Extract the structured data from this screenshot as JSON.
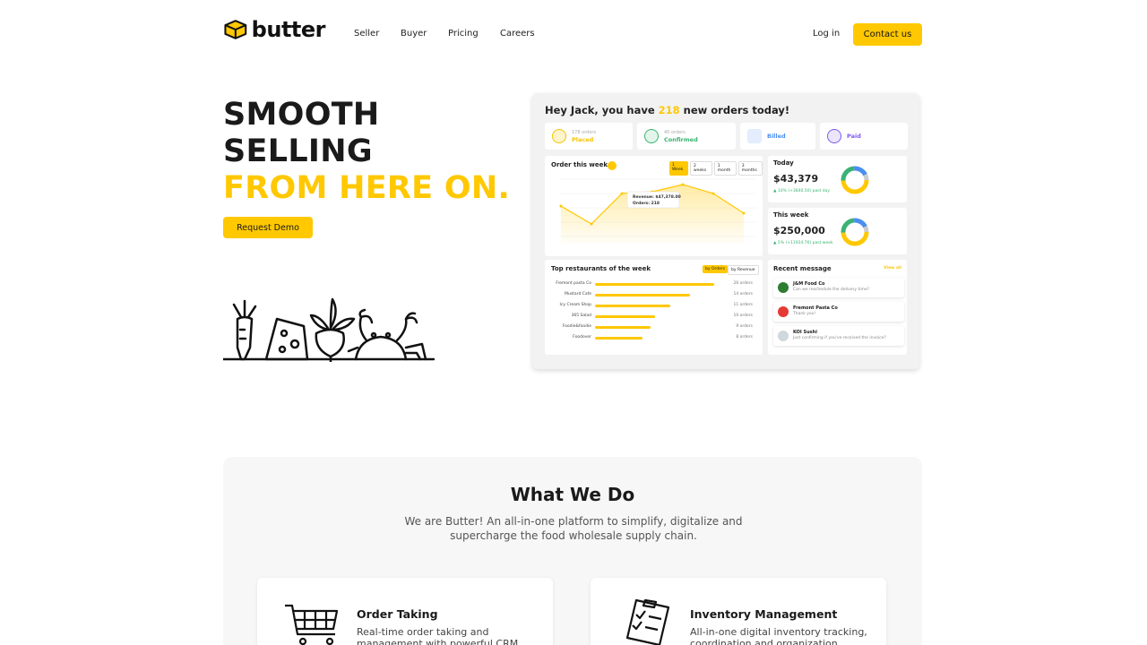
{
  "nav": {
    "brand": "butter",
    "links": [
      "Seller",
      "Buyer",
      "Pricing",
      "Careers"
    ],
    "login": "Log in",
    "contact": "Contact us"
  },
  "hero": {
    "line1": "SMOOTH",
    "line2": "SELLING",
    "line3": "FROM HERE ON.",
    "cta": "Request Demo"
  },
  "dashboard": {
    "greeting_pre": "Hey Jack, you have ",
    "greeting_num": "218",
    "greeting_post": " new orders today!",
    "stats": [
      {
        "small": "178 orders",
        "label": "Placed",
        "color": "#f5c400"
      },
      {
        "small": "40 orders",
        "label": "Confirmed",
        "color": "#3bb273"
      },
      {
        "small": "",
        "label": "Billed",
        "color": "#4a8ef0"
      },
      {
        "small": "",
        "label": "Paid",
        "color": "#7a5af5"
      }
    ],
    "chart_title": "Order this week",
    "ranges": [
      "1 Week",
      "2 weeks",
      "1 month",
      "3 months"
    ],
    "tooltip1": "Revenue: $47,378.00",
    "tooltip2": "Orders: 218",
    "today_label": "Today",
    "today_value": "$43,379",
    "today_note": "▲ 10% (+3840.50) past day",
    "week_label": "This week",
    "week_value": "$250,000",
    "week_note": "▲ 5% (+11934.76) past week",
    "top_title": "Top restaurants of the week",
    "top_tabs": [
      "by Orders",
      "by Revenue"
    ],
    "top": [
      {
        "name": "Fremont pasta Co",
        "count": "26 orders",
        "pct": 0.95
      },
      {
        "name": "Mustard Cafe",
        "count": "14 orders",
        "pct": 0.76
      },
      {
        "name": "Icy Cream Shop",
        "count": "11 orders",
        "pct": 0.6
      },
      {
        "name": "365 Salad",
        "count": "10 orders",
        "pct": 0.48
      },
      {
        "name": "Foodie&foodie",
        "count": "9 orders",
        "pct": 0.44
      },
      {
        "name": "Foodover",
        "count": "8 orders",
        "pct": 0.38
      }
    ],
    "recent_title": "Recent message",
    "view_all": "View all",
    "messages": [
      {
        "name": "J&M Food Co",
        "text": "Can we reschedule the delivery time?",
        "color": "#2e7d32"
      },
      {
        "name": "Fremont Pasta Co",
        "text": "Thank you!",
        "color": "#e53935"
      },
      {
        "name": "KOI Sushi",
        "text": "Just confirming if you've received the invoice?",
        "color": "#90a4ae"
      }
    ]
  },
  "what": {
    "title": "What We Do",
    "sub": "We are Butter! An all-in-one platform to simplify, digitalize and supercharge the food wholesale supply chain.",
    "cards": [
      {
        "title": "Order Taking",
        "desc": "Real-time order taking and management with powerful CRM"
      },
      {
        "title": "Inventory Management",
        "desc": "All-in-one digital inventory tracking, coordination and organization"
      }
    ]
  },
  "colors": {
    "accent": "#ffc800"
  }
}
